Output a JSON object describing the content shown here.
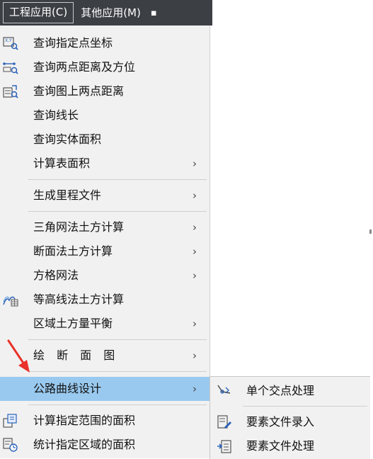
{
  "menubar": {
    "items": [
      "工程应用(C)",
      "其他应用(M)"
    ]
  },
  "menu": {
    "items": [
      {
        "label": "查询指定点坐标",
        "icon": "point-coordinate-icon"
      },
      {
        "label": "查询两点距离及方位",
        "icon": "distance-bearing-icon"
      },
      {
        "label": "查询图上两点距离",
        "icon": "map-distance-icon"
      },
      {
        "label": "查询线长",
        "icon": ""
      },
      {
        "label": "查询实体面积",
        "icon": ""
      },
      {
        "label": "计算表面积",
        "submenu": true
      },
      {
        "label": "生成里程文件",
        "submenu": true
      },
      {
        "label": "三角网法土方计算",
        "submenu": true
      },
      {
        "label": "断面法土方计算",
        "submenu": true
      },
      {
        "label": "方格网法",
        "submenu": true
      },
      {
        "label": "等高线法土方计算",
        "icon": "contour-earthwork-icon"
      },
      {
        "label": "区域土方量平衡",
        "submenu": true
      },
      {
        "label": "绘 断 面 图",
        "submenu": true
      },
      {
        "label": "公路曲线设计",
        "submenu": true,
        "highlighted": true
      },
      {
        "label": "计算指定范围的面积",
        "icon": "range-area-icon"
      },
      {
        "label": "统计指定区域的面积",
        "icon": "region-area-icon"
      }
    ],
    "submenu_arrow": "›"
  },
  "submenu": {
    "items": [
      {
        "label": "单个交点处理",
        "icon": "intersection-process-icon"
      },
      {
        "label": "要素文件录入",
        "icon": "file-entry-icon"
      },
      {
        "label": "要素文件处理",
        "icon": "file-process-icon"
      }
    ]
  },
  "colors": {
    "menubar_bg": "#3c3f44",
    "menu_bg": "#f1f1f1",
    "highlight": "#99c9ef",
    "pointer": "#e8322a"
  }
}
